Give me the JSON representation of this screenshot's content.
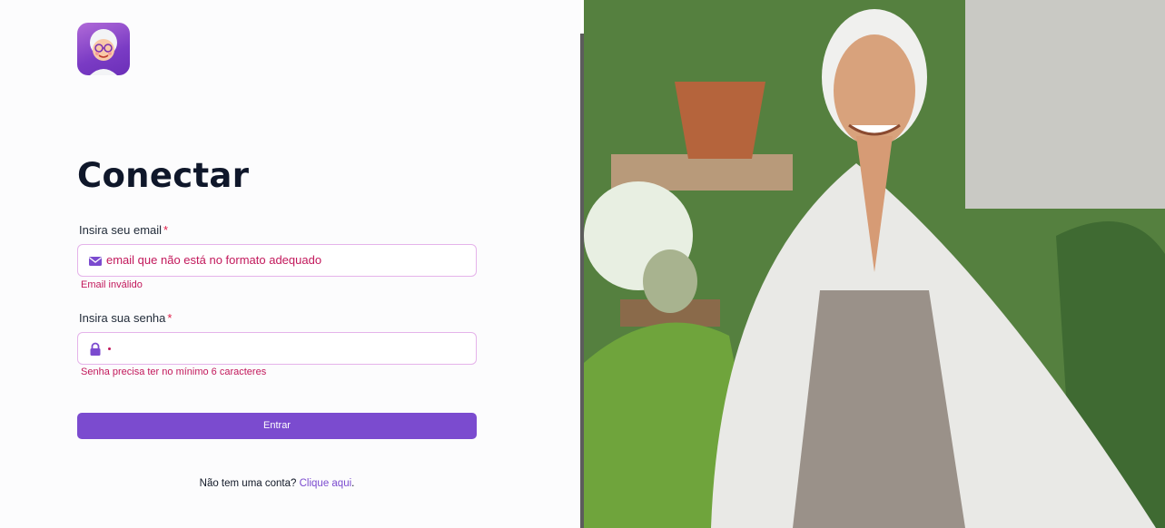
{
  "page": {
    "title": "Conectar"
  },
  "form": {
    "email_label": "Insira seu email",
    "required_mark": "*",
    "email_value": "email que não está no formato adequado",
    "email_error": "Email inválido",
    "password_label": "Insira sua senha",
    "password_error": "Senha precisa ter no mínimo 6 caracteres",
    "submit_label": "Entrar"
  },
  "signup": {
    "prompt": "Não tem uma conta?",
    "link": "Clique aqui",
    "suffix": "."
  },
  "icons": {
    "logo": "grandmother-avatar-icon",
    "email": "envelope-icon",
    "password": "lock-icon"
  },
  "colors": {
    "accent": "#7b4bcf",
    "error": "#c2185b",
    "title": "#0f172a"
  }
}
